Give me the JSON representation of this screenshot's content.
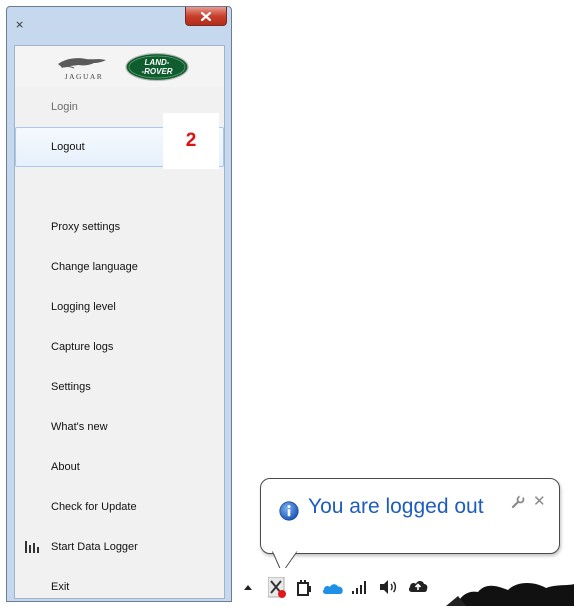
{
  "window": {
    "app_icon_glyph": "⨯",
    "close_glyph": "x"
  },
  "logos": {
    "jaguar_text": "JAGUAR",
    "landrover_line1": "LAND-",
    "landrover_line2": "-ROVER"
  },
  "menu": {
    "items": [
      {
        "label": "Login",
        "state": "disabled"
      },
      {
        "label": "Logout",
        "state": "selected"
      },
      {
        "label": "Proxy settings"
      },
      {
        "label": "Change language"
      },
      {
        "label": "Logging level"
      },
      {
        "label": "Capture logs"
      },
      {
        "label": "Settings"
      },
      {
        "label": "What's new"
      },
      {
        "label": "About"
      },
      {
        "label": "Check for Update"
      },
      {
        "label": "Start Data Logger",
        "icon": "bar-chart-icon"
      },
      {
        "label": "Exit"
      }
    ]
  },
  "annotation": {
    "step_number": "2"
  },
  "notification": {
    "message": "You are logged out",
    "icon": "info-icon",
    "close_glyph": "✕"
  },
  "taskbar": {
    "icons": [
      "show-hidden-icons-chevron-icon",
      "app-tray-icon",
      "device-icon",
      "onedrive-cloud-icon",
      "network-signal-icon",
      "volume-icon",
      "upload-cloud-icon"
    ]
  },
  "colors": {
    "window_frame": "#c5d8ee",
    "close_button": "#c8402c",
    "step_number": "#e01010",
    "notification_text": "#1e5dbf",
    "landrover_green": "#0f5c2e"
  }
}
